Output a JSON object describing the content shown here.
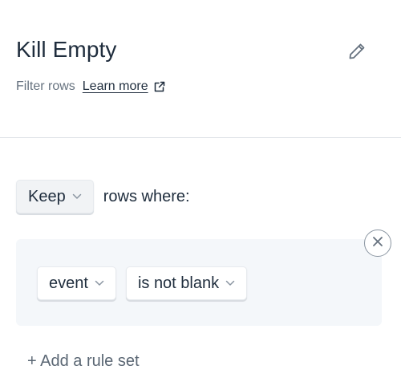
{
  "header": {
    "title": "Kill Empty",
    "subtitle": "Filter rows",
    "learn_more": "Learn more",
    "edit_icon": "pencil-icon",
    "external_icon": "external-link-icon"
  },
  "filter": {
    "mode": "Keep",
    "after_text": "rows where:",
    "rule": {
      "column": "event",
      "condition": "is not blank"
    },
    "remove_icon": "close-circle-icon",
    "add_ruleset_label": "+ Add a rule set"
  },
  "colors": {
    "text": "#1f2d3d",
    "muted": "#66727f",
    "ruleset_bg": "#f4f7fa",
    "divider": "#dfe3e7"
  }
}
